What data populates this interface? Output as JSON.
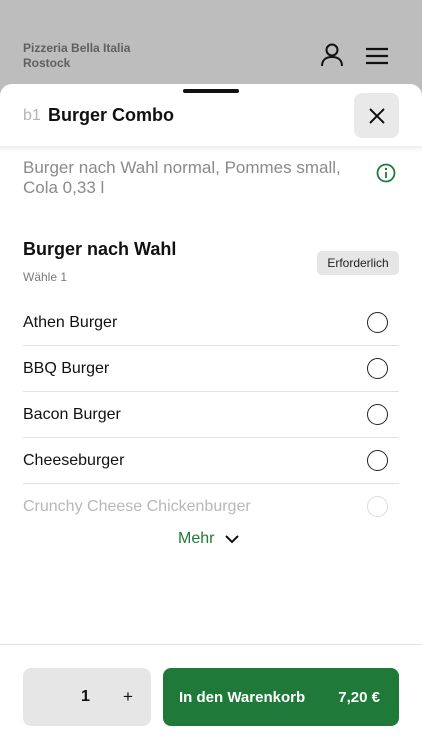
{
  "topbar": {
    "restaurant_name": "Pizzeria Bella Italia",
    "restaurant_city": "Rostock",
    "user_icon": "user-icon",
    "menu_icon": "hamburger-menu-icon"
  },
  "product": {
    "code": "b1",
    "title": "Burger Combo",
    "description": "Burger nach Wahl normal, Pommes small, Cola 0,33 l",
    "info_icon": "info-icon",
    "close_icon": "close-icon"
  },
  "option_group": {
    "title": "Burger nach Wahl",
    "subtitle": "Wähle 1",
    "badge": "Erforderlich",
    "options": [
      {
        "label": "Athen Burger",
        "selected": false
      },
      {
        "label": "BBQ Burger",
        "selected": false
      },
      {
        "label": "Bacon Burger",
        "selected": false
      },
      {
        "label": "Cheeseburger",
        "selected": false
      },
      {
        "label": "Crunchy Cheese Chickenburger",
        "selected": false
      }
    ],
    "more_label": "Mehr"
  },
  "footer": {
    "quantity": "1",
    "plus": "+",
    "cart_label": "In den Warenkorb",
    "price": "7,20 €"
  },
  "colors": {
    "accent_green": "#1f7a3a",
    "backdrop_gray": "#bdbdbd"
  }
}
